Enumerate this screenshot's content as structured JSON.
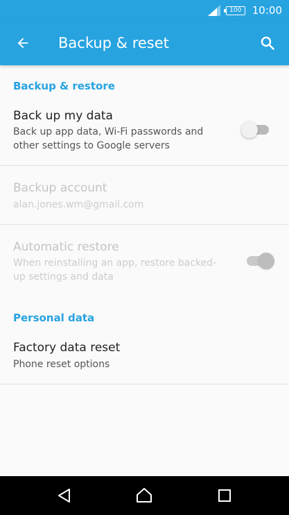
{
  "status_bar": {
    "battery": "100",
    "time": "10:00"
  },
  "app_bar": {
    "title": "Backup & reset",
    "back_icon": "arrow-left-icon",
    "search_icon": "search-icon"
  },
  "sections": {
    "backup_restore": {
      "header": "Backup & restore",
      "back_up": {
        "title": "Back up my data",
        "subtitle": "Back up app data, Wi-Fi passwords and other settings to Google servers",
        "toggle": "off"
      },
      "backup_account": {
        "title": "Backup account",
        "subtitle": "alan.jones.wm@gmail.com"
      },
      "auto_restore": {
        "title": "Automatic restore",
        "subtitle": "When reinstalling an app, restore backed-up settings and data",
        "toggle": "on"
      }
    },
    "personal_data": {
      "header": "Personal data",
      "factory_reset": {
        "title": "Factory data reset",
        "subtitle": "Phone reset options"
      }
    }
  },
  "colors": {
    "accent": "#27a3e0",
    "background": "#fafafa",
    "nav_bar": "#000000"
  }
}
